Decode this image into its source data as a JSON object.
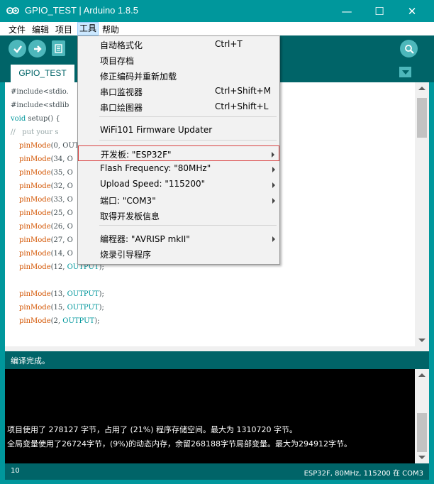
{
  "window": {
    "title": "GPIO_TEST | Arduino 1.8.5",
    "controls": [
      "—",
      "☐",
      "✕"
    ]
  },
  "menubar": [
    "文件",
    "编辑",
    "项目",
    "工具",
    "帮助"
  ],
  "tab": {
    "name": "GPIO_TEST"
  },
  "code_lines": [
    {
      "p": "#include<stdio.",
      "t": "pre"
    },
    {
      "p": "#include<stdlib",
      "t": "pre"
    },
    {
      "p": "void setup() {",
      "t": "setup"
    },
    {
      "p": "//   put your s",
      "t": "comment"
    },
    {
      "fn": "pinMode",
      "args": "(0, OUTP"
    },
    {
      "fn": "pinMode",
      "args": "(34, O"
    },
    {
      "fn": "pinMode",
      "args": "(35, O"
    },
    {
      "fn": "pinMode",
      "args": "(32, O"
    },
    {
      "fn": "pinMode",
      "args": "(33, O"
    },
    {
      "fn": "pinMode",
      "args": "(25, O"
    },
    {
      "fn": "pinMode",
      "args": "(26, O"
    },
    {
      "fn": "pinMode",
      "args": "(27, O"
    },
    {
      "fn": "pinMode",
      "args": "(14, O"
    },
    {
      "fn": "pinMode",
      "args": "(12, ",
      "kw": "OUTPUT",
      "end": ");"
    },
    {
      "blank": true
    },
    {
      "fn": "pinMode",
      "args": "(13, ",
      "kw": "OUTPUT",
      "end": ");"
    },
    {
      "fn": "pinMode",
      "args": "(15, ",
      "kw": "OUTPUT",
      "end": ");"
    },
    {
      "fn": "pinMode",
      "args": "(2, ",
      "kw": "OUTPUT",
      "end": ");"
    }
  ],
  "tools_menu": {
    "items": [
      {
        "label": "自动格式化",
        "shortcut": "Ctrl+T"
      },
      {
        "label": "项目存档",
        "shortcut": ""
      },
      {
        "label": "修正编码并重新加载",
        "shortcut": ""
      },
      {
        "label": "串口监视器",
        "shortcut": "Ctrl+Shift+M"
      },
      {
        "label": "串口绘图器",
        "shortcut": "Ctrl+Shift+L"
      },
      {
        "label": "WiFi101 Firmware Updater",
        "shortcut": ""
      },
      {
        "label": "开发板: \"ESP32F\"",
        "submenu": true,
        "selected": true
      },
      {
        "label": "Flash Frequency: \"80MHz\"",
        "submenu": true
      },
      {
        "label": "Upload Speed: \"115200\"",
        "submenu": true
      },
      {
        "label": "端口: \"COM3\"",
        "submenu": true
      },
      {
        "label": "取得开发板信息",
        "shortcut": ""
      },
      {
        "label": "编程器: \"AVRISP mkII\"",
        "submenu": true
      },
      {
        "label": "烧录引导程序",
        "shortcut": ""
      }
    ]
  },
  "status": {
    "message": "编译完成。"
  },
  "console": {
    "line1": "项目使用了 278127 字节，占用了 (21%) 程序存储空间。最大为 1310720 字节。",
    "line2": "全局变量使用了26724字节，(9%)的动态内存，余留268188字节局部变量。最大为294912字节。"
  },
  "footer": {
    "line": "10",
    "board": "ESP32F, 80MHz, 115200 在 COM3"
  },
  "colors": {
    "teal": "#00979c",
    "dark_teal": "#006468",
    "orange": "#d35400",
    "selection_border": "#d94040"
  },
  "icons": [
    "arduino-logo-icon",
    "verify-icon",
    "upload-icon",
    "new-icon",
    "serial-monitor-icon",
    "tab-menu-icon"
  ]
}
